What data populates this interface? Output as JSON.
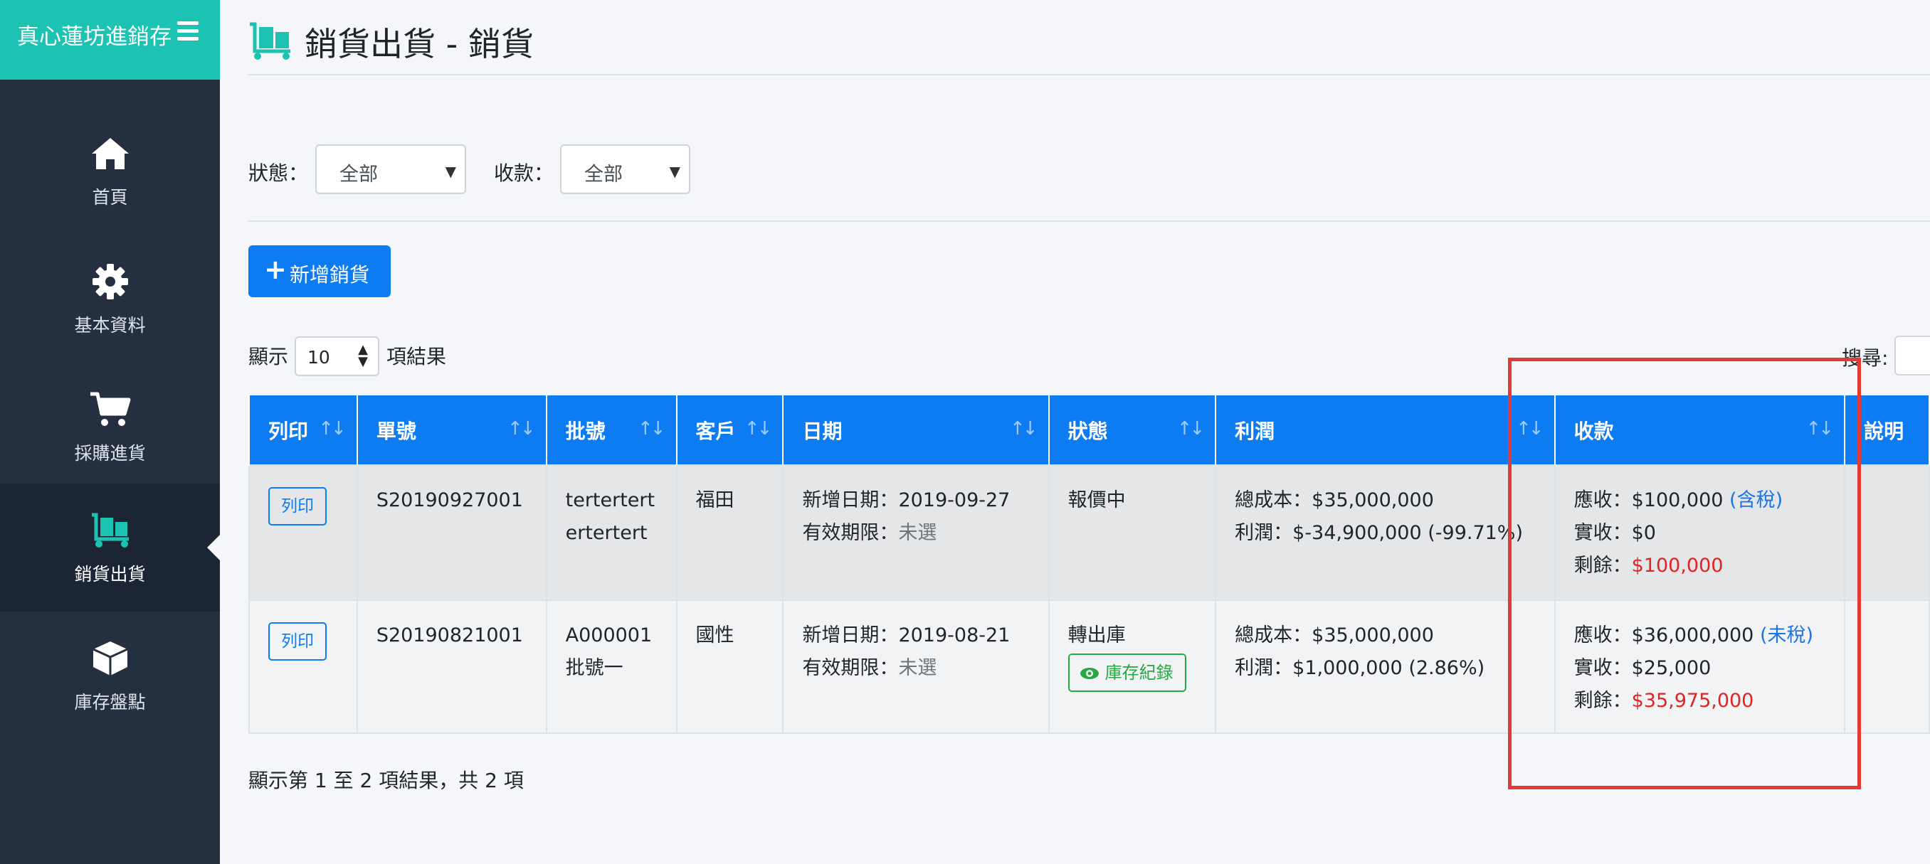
{
  "app": {
    "brand": "真心蓮坊進銷存",
    "menu_icon": "hamburger-icon"
  },
  "sidebar": {
    "items": [
      {
        "label": "首頁",
        "icon": "home-icon"
      },
      {
        "label": "基本資料",
        "icon": "gear-icon"
      },
      {
        "label": "採購進貨",
        "icon": "cart-icon"
      },
      {
        "label": "銷貨出貨",
        "icon": "dolly-icon",
        "active": true
      },
      {
        "label": "庫存盤點",
        "icon": "box-icon"
      }
    ]
  },
  "page": {
    "title": "銷貨出貨 - 銷貨",
    "icon": "dolly-icon"
  },
  "filters": {
    "status_label": "狀態：",
    "status_value": "全部",
    "payment_label": "收款：",
    "payment_value": "全部"
  },
  "actions": {
    "add_label": "新增銷貨"
  },
  "table_controls": {
    "show_label": "顯示",
    "page_length": "10",
    "results_label": "項結果",
    "search_label": "搜尋:"
  },
  "table": {
    "columns": [
      "列印",
      "單號",
      "批號",
      "客戶",
      "日期",
      "狀態",
      "利潤",
      "收款",
      "說明"
    ],
    "rows": [
      {
        "print_label": "列印",
        "order_no": "S20190927001",
        "batch_lines": [
          "tertertert",
          "ertertert"
        ],
        "customer": "福田",
        "created_label": "新增日期：",
        "created_date": "2019-09-27",
        "expiry_label": "有效期限：",
        "expiry_value": "未選",
        "status": "報價中",
        "status_button": "",
        "cost_line": "總成本：$35,000,000",
        "profit_line": "利潤：$-34,900,000 (-99.71%)",
        "receivable_label": "應收：",
        "receivable": "$100,000",
        "tax_note": "(含稅)",
        "received_line": "實收：$0",
        "remaining_label": "剩餘：",
        "remaining": "$100,000",
        "note": ""
      },
      {
        "print_label": "列印",
        "order_no": "S20190821001",
        "batch_lines": [
          "A000001",
          "批號一"
        ],
        "customer": "國性",
        "created_label": "新增日期：",
        "created_date": "2019-08-21",
        "expiry_label": "有效期限：",
        "expiry_value": "未選",
        "status": "轉出庫",
        "status_button": "庫存紀錄",
        "cost_line": "總成本：$35,000,000",
        "profit_line": "利潤：$1,000,000 (2.86%)",
        "receivable_label": "應收：",
        "receivable": "$36,000,000",
        "tax_note": "(未稅)",
        "received_line": "實收：$25,000",
        "remaining_label": "剩餘：",
        "remaining": "$35,975,000",
        "note": ""
      }
    ]
  },
  "footer": {
    "info": "顯示第 1 至 2 項結果，共 2 項"
  },
  "colors": {
    "brand": "#1cc3b2",
    "sidebar": "#243040",
    "primary": "#0d7cf2",
    "danger": "#e02424",
    "success": "#28a745",
    "highlight": "#e53935"
  }
}
